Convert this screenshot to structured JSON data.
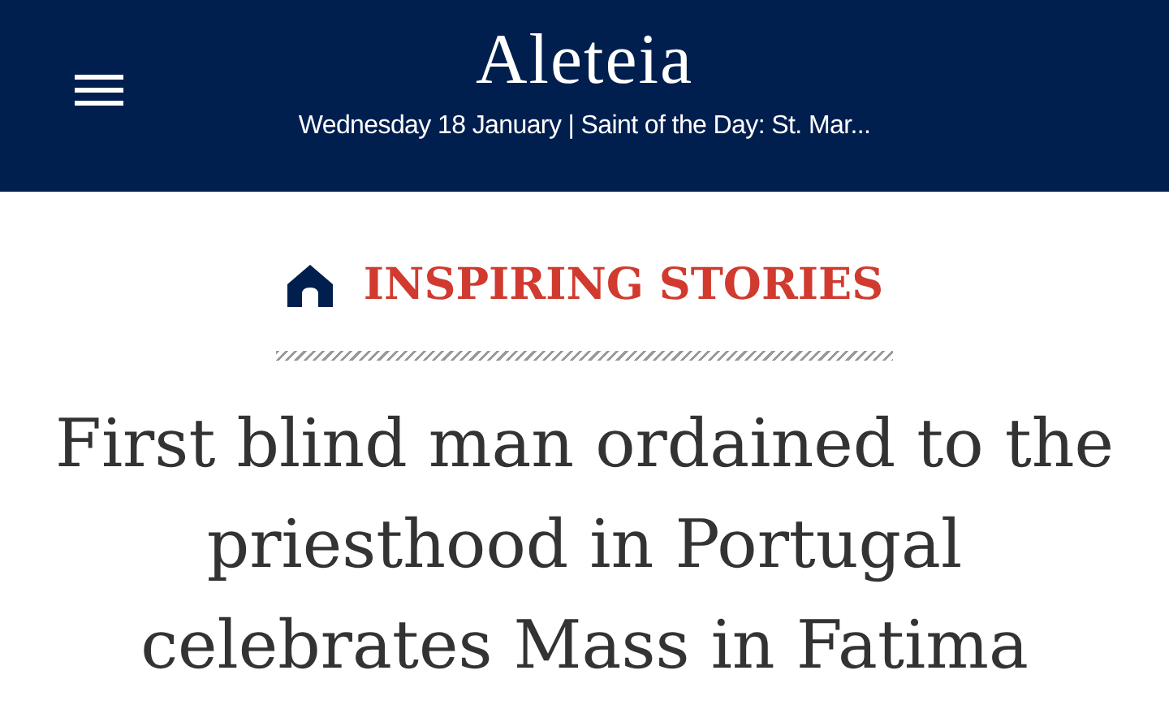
{
  "header": {
    "logo": "Aleteia",
    "date_line": "Wednesday 18 January | Saint of the Day: St. Mar..."
  },
  "category": {
    "label": "INSPIRING STORIES"
  },
  "article": {
    "headline": "First blind man ordained to the priesthood in Portugal celebrates Mass in Fatima"
  }
}
